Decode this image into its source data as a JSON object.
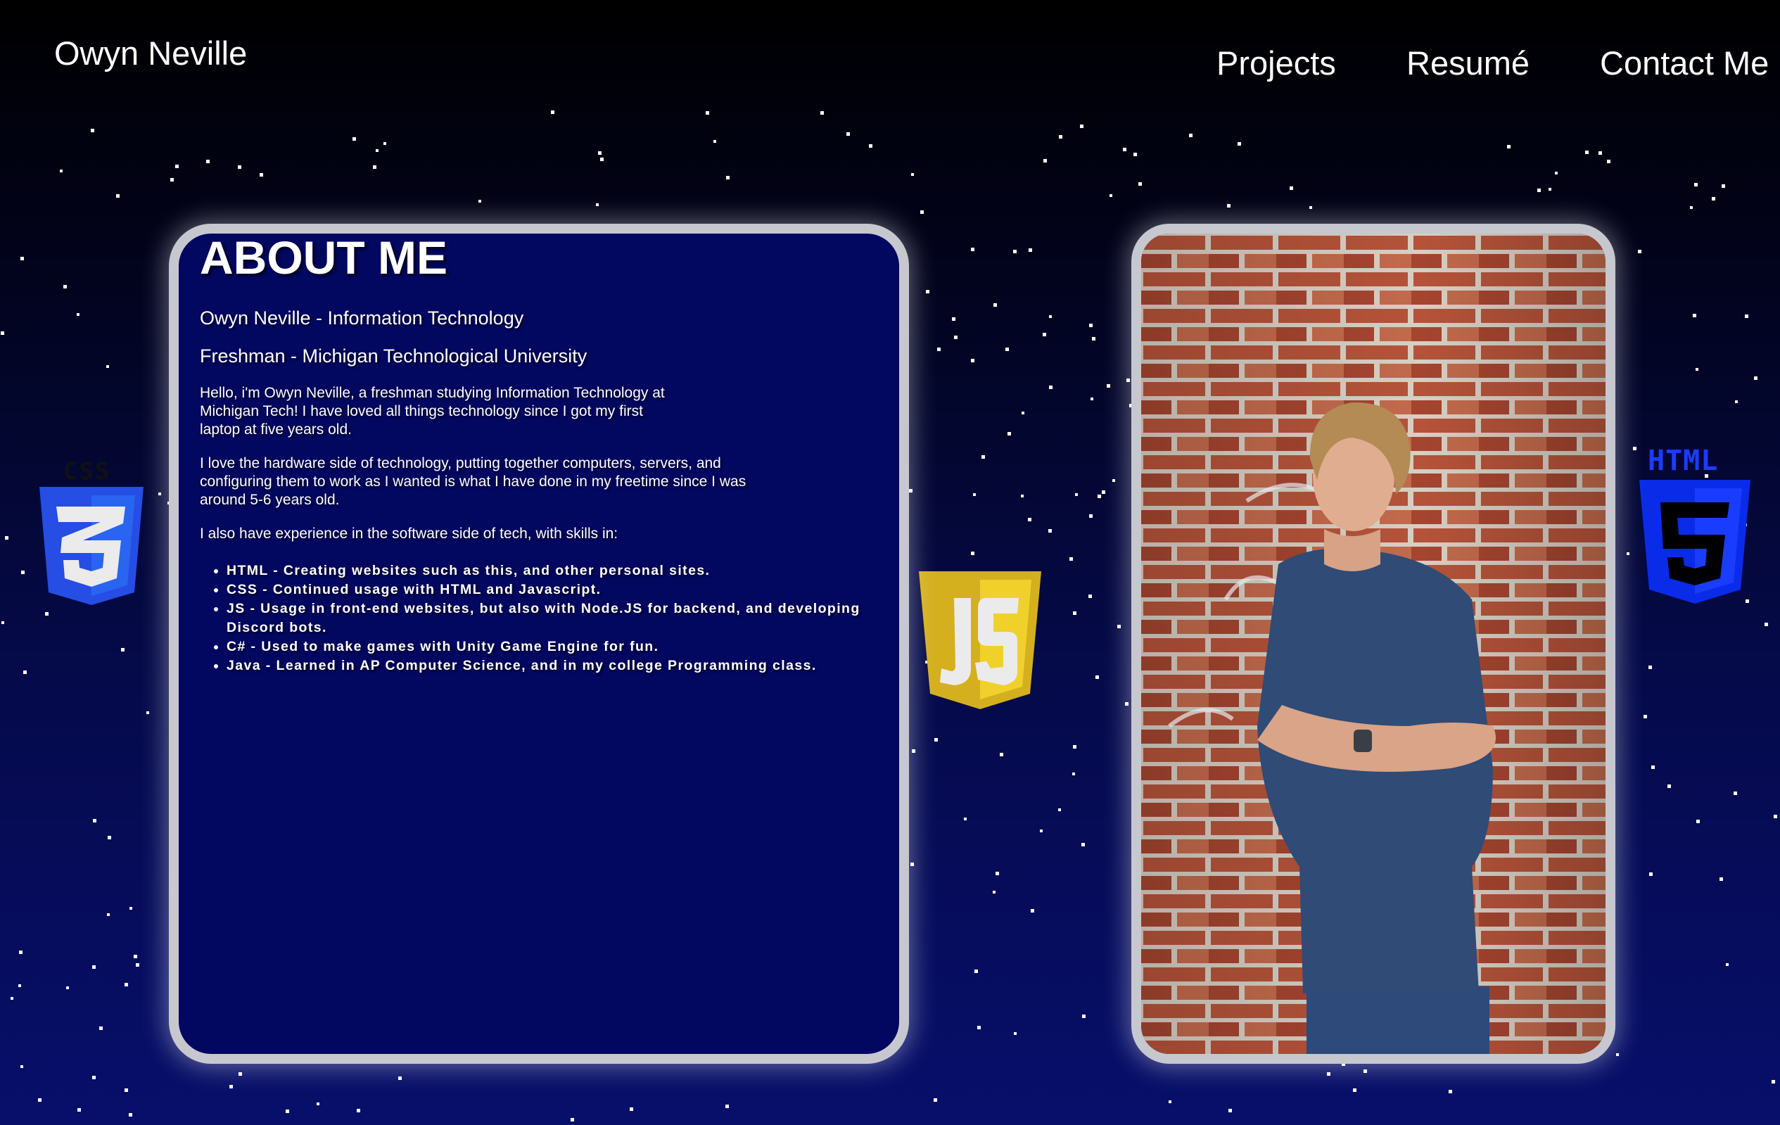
{
  "header": {
    "brand": "Owyn Neville",
    "nav": {
      "projects": "Projects",
      "resume": "Resumé",
      "contact": "Contact Me"
    }
  },
  "about": {
    "title": "ABOUT ME",
    "line1": "Owyn Neville - Information Technology",
    "line2": "Freshman - Michigan Technological University",
    "intro": "Hello, i'm Owyn Neville, a freshman studying Information Technology at Michigan Tech! I have loved all things technology since I got my first laptop at five years old.",
    "hardware": "I love the hardware side of technology, putting together computers, servers, and configuring them to work as I wanted is what I have done in my freetime since I was around 5-6 years old.",
    "software": "I also have experience in the software side of tech, with skills in:",
    "skills": [
      "HTML - Creating websites such as this, and other personal sites.",
      "CSS - Continued usage with HTML and Javascript.",
      "JS - Usage in front-end websites, but also with Node.JS for backend, and developing Discord bots.",
      "C# - Used to make games with Unity Game Engine for fun.",
      "Java - Learned in AP Computer Science, and in my college Programming class."
    ]
  },
  "logos": {
    "css": {
      "icon": "css3-icon",
      "label": "CSS",
      "color": "#264de4"
    },
    "js": {
      "icon": "javascript-icon",
      "label": "JS",
      "color": "#e8c520"
    },
    "html": {
      "icon": "html5-icon",
      "label": "HTML",
      "color": "#0a2be8"
    }
  },
  "photo": {
    "icon": "portrait-photo"
  },
  "colors": {
    "card_background": "#020760",
    "card_border": "#c7c7cf",
    "page_background_top": "#000000",
    "page_background_bottom": "#070f6b",
    "text": "#ffffff"
  }
}
